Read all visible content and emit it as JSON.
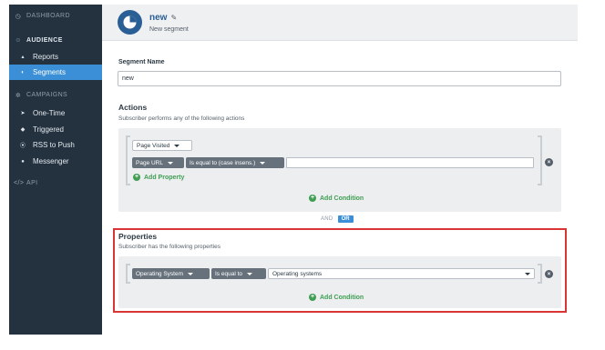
{
  "sidebar": {
    "dashboard": "DASHBOARD",
    "audience": "AUDIENCE",
    "reports": "Reports",
    "segments": "Segments",
    "campaigns": "CAMPAIGNS",
    "one_time": "One-Time",
    "triggered": "Triggered",
    "rss_to_push": "RSS to Push",
    "messenger": "Messenger",
    "api": "API"
  },
  "header": {
    "title": "new",
    "subtitle": "New segment"
  },
  "form": {
    "segment_name_label": "Segment Name",
    "segment_name_value": "new"
  },
  "actions": {
    "title": "Actions",
    "description": "Subscriber performs any of the following actions",
    "event_select": "Page Visited",
    "field_select": "Page URL",
    "operator_select": "Is equal to (case insens.)",
    "value": "",
    "add_property": "Add Property",
    "add_condition": "Add Condition"
  },
  "logic": {
    "and_label": "AND",
    "or_label": "OR"
  },
  "properties": {
    "title": "Properties",
    "description": "Subscriber has the following properties",
    "property_select": "Operating System",
    "operator_select": "Is equal to",
    "value_select": "Operating systems",
    "add_condition": "Add Condition"
  },
  "colors": {
    "sidebar_bg": "#243240",
    "active_blue": "#3b8fd6",
    "green": "#3f9e52",
    "highlight_red": "#d93535",
    "brand_blue": "#2a5f96"
  },
  "icons": {
    "dashboard": "dashboard-icon",
    "audience": "users-icon",
    "reports": "bar-chart-icon",
    "segments": "pie-chart-icon",
    "campaigns": "gear-icon",
    "one_time": "send-icon",
    "triggered": "tag-icon",
    "rss": "rss-icon",
    "messenger": "chat-icon",
    "api": "code-icon",
    "edit": "pencil-icon"
  }
}
